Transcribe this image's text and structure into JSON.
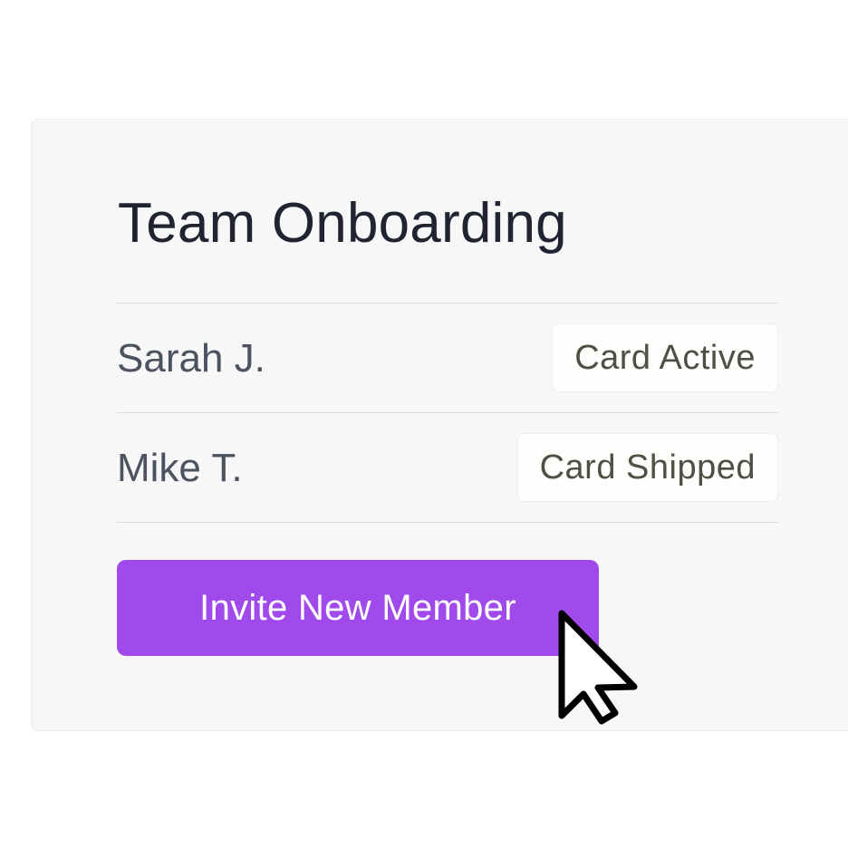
{
  "card": {
    "title": "Team Onboarding",
    "members": [
      {
        "name": "Sarah J.",
        "status": "Card Active"
      },
      {
        "name": "Mike T.",
        "status": "Card Shipped"
      }
    ],
    "invite_label": "Invite New Member"
  },
  "colors": {
    "accent": "#a04aeb",
    "title_text": "#1f2430",
    "card_background": "#f7f7f8"
  },
  "icons": {
    "cursor": "mouse-pointer-icon"
  }
}
